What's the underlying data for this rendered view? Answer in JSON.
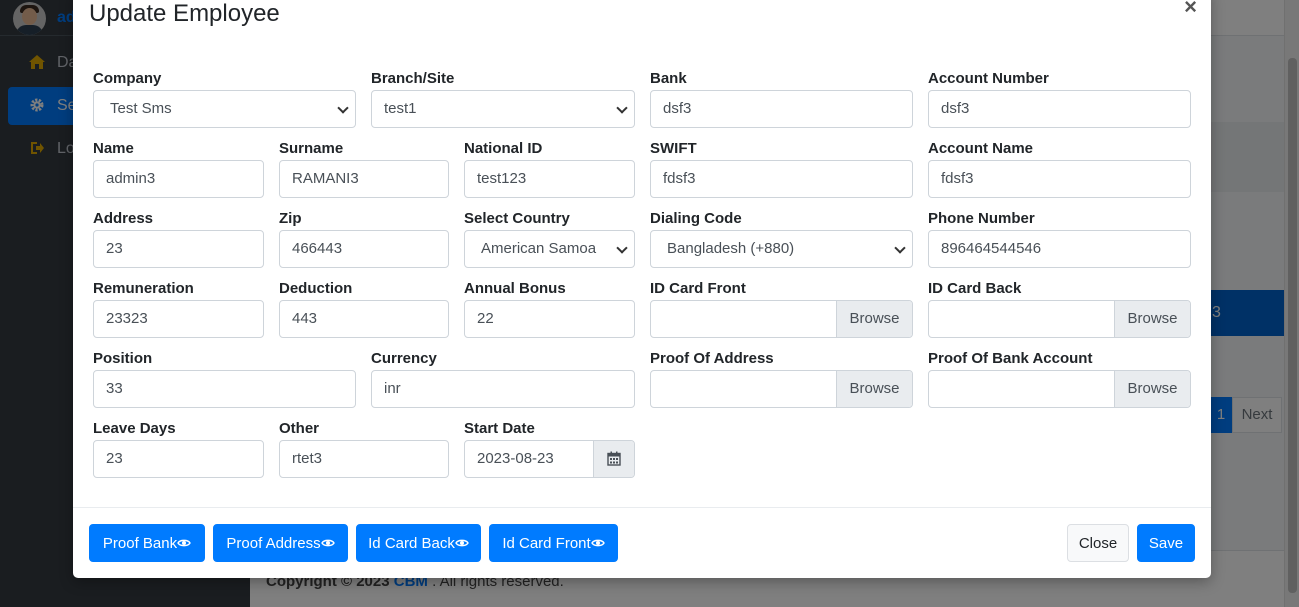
{
  "background": {
    "brand_text": "ad",
    "nav": [
      {
        "label": "Da",
        "icon": "home-icon"
      },
      {
        "label": "Se",
        "icon": "gear-icon"
      },
      {
        "label": "Lo",
        "icon": "logout-icon"
      }
    ],
    "table_cell_text": "3",
    "pagination": {
      "current": "1",
      "next": "Next"
    },
    "footer": {
      "prefix": "Copyright © 2023 ",
      "brand": "CBM",
      "suffix": " . All rights reserved."
    }
  },
  "modal": {
    "title": "Update Employee",
    "close_symbol": "×",
    "fields": {
      "company": {
        "label": "Company",
        "value": "Test Sms"
      },
      "branch": {
        "label": "Branch/Site",
        "value": "test1"
      },
      "bank": {
        "label": "Bank",
        "value": "dsf3"
      },
      "account_number": {
        "label": "Account Number",
        "value": "dsf3"
      },
      "name": {
        "label": "Name",
        "value": "admin3"
      },
      "surname": {
        "label": "Surname",
        "value": "RAMANI3"
      },
      "national_id": {
        "label": "National ID",
        "value": "test123"
      },
      "swift": {
        "label": "SWIFT",
        "value": "fdsf3"
      },
      "account_name": {
        "label": "Account Name",
        "value": "fdsf3"
      },
      "address": {
        "label": "Address",
        "value": "23"
      },
      "zip": {
        "label": "Zip",
        "value": "466443"
      },
      "country": {
        "label": "Select Country",
        "value": "American Samoa"
      },
      "dialing_code": {
        "label": "Dialing Code",
        "value": "Bangladesh (+880)"
      },
      "phone": {
        "label": "Phone Number",
        "value": "896464544546"
      },
      "remuneration": {
        "label": "Remuneration",
        "value": "23323"
      },
      "deduction": {
        "label": "Deduction",
        "value": "443"
      },
      "annual_bonus": {
        "label": "Annual Bonus",
        "value": "22"
      },
      "id_card_front": {
        "label": "ID Card Front",
        "browse": "Browse"
      },
      "id_card_back": {
        "label": "ID Card Back",
        "browse": "Browse"
      },
      "position": {
        "label": "Position",
        "value": "33"
      },
      "currency": {
        "label": "Currency",
        "value": "inr"
      },
      "proof_of_address": {
        "label": "Proof Of Address",
        "browse": "Browse"
      },
      "proof_of_bank": {
        "label": "Proof Of Bank Account",
        "browse": "Browse"
      },
      "leave_days": {
        "label": "Leave Days",
        "value": "23"
      },
      "other": {
        "label": "Other",
        "value": "rtet3"
      },
      "start_date": {
        "label": "Start Date",
        "value": "2023-08-23"
      }
    },
    "footer_buttons": {
      "proof_bank": "Proof Bank",
      "proof_address": "Proof Address",
      "id_card_back": "Id Card Back",
      "id_card_front": "Id Card Front",
      "close": "Close",
      "save": "Save"
    }
  },
  "colors": {
    "primary": "#007bff",
    "sidebar": "#343a40"
  }
}
